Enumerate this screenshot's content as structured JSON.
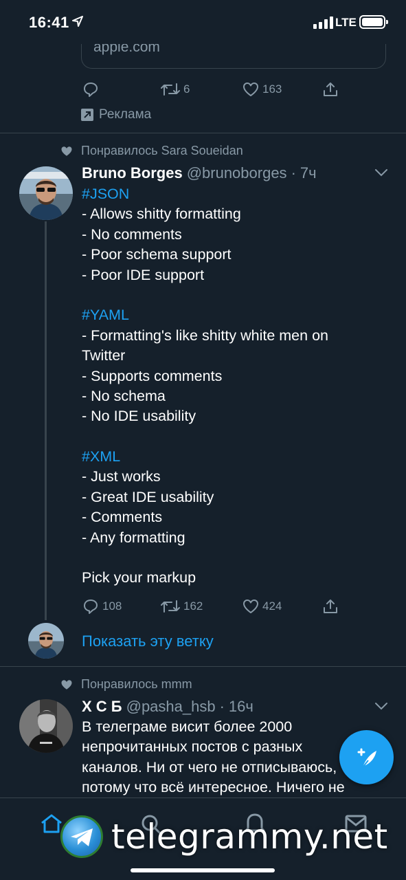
{
  "status_bar": {
    "time": "16:41",
    "network": "LTE"
  },
  "prev_tweet": {
    "card_domain": "apple.com",
    "retweets": "6",
    "likes": "163",
    "promoted_label": "Реклама"
  },
  "tweet1": {
    "social_context": "Понравилось Sara Soueidan",
    "name": "Bruno Borges",
    "handle": "@brunoborges",
    "separator": "·",
    "time": "7ч",
    "lines": [
      {
        "text": "#JSON",
        "hashtag": true
      },
      {
        "text": "- Allows shitty formatting",
        "hashtag": false
      },
      {
        "text": "- No comments",
        "hashtag": false
      },
      {
        "text": "- Poor schema support",
        "hashtag": false
      },
      {
        "text": "- Poor IDE support",
        "hashtag": false
      },
      {
        "text": "",
        "hashtag": false
      },
      {
        "text": "#YAML",
        "hashtag": true
      },
      {
        "text": "- Formatting's like shitty white men on",
        "hashtag": false
      },
      {
        "text": "Twitter",
        "hashtag": false
      },
      {
        "text": "- Supports comments",
        "hashtag": false
      },
      {
        "text": "- No schema",
        "hashtag": false
      },
      {
        "text": "- No IDE usability",
        "hashtag": false
      },
      {
        "text": "",
        "hashtag": false
      },
      {
        "text": "#XML",
        "hashtag": true
      },
      {
        "text": "- Just works",
        "hashtag": false
      },
      {
        "text": "- Great IDE usability",
        "hashtag": false
      },
      {
        "text": "- Comments",
        "hashtag": false
      },
      {
        "text": "- Any formatting",
        "hashtag": false
      },
      {
        "text": "",
        "hashtag": false
      },
      {
        "text": "Pick your markup",
        "hashtag": false
      }
    ],
    "replies": "108",
    "retweets": "162",
    "likes": "424",
    "show_thread": "Показать эту ветку"
  },
  "tweet2": {
    "social_context": "Понравилось mmm",
    "name": "Х С Б",
    "handle": "@pasha_hsb",
    "separator": "·",
    "time": "16ч",
    "lines": [
      "В телеграме висит более 2000",
      "непрочитанных постов с разных",
      "каналов. Ни от чего не отписываюсь,",
      "потому что всё интересное. Ничего не"
    ]
  },
  "watermark": {
    "text": "telegrammy.net"
  },
  "colors": {
    "background": "#15202b",
    "accent": "#1da1f2",
    "secondary_text": "#8899a6",
    "divider": "#38444d"
  }
}
